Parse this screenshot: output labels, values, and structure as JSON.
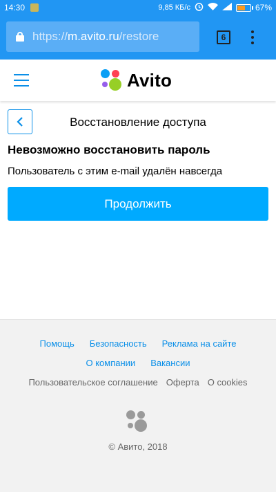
{
  "status_bar": {
    "time": "14:30",
    "speed": "9,85 КБ/с",
    "battery": "67%",
    "battery_level": 0.67
  },
  "browser": {
    "url_scheme": "https://",
    "url_host": "m.avito.ru",
    "url_path": "/restore",
    "tab_count": "6"
  },
  "header": {
    "logo_text": "Avito"
  },
  "main": {
    "page_title": "Восстановление доступа",
    "heading": "Невозможно восстановить пароль",
    "message": "Пользователь с этим e-mail удалён навсегда",
    "continue_label": "Продолжить"
  },
  "footer": {
    "row1": [
      "Помощь",
      "Безопасность",
      "Реклама на сайте"
    ],
    "row2": [
      "О компании",
      "Вакансии"
    ],
    "row3": [
      "Пользовательское соглашение",
      "Оферта",
      "О cookies"
    ],
    "copyright": "© Авито, 2018"
  },
  "colors": {
    "accent": "#2196f3",
    "link": "#0a8fe8",
    "button": "#00aaff",
    "logo_blue": "#0a9ff5",
    "logo_red": "#ff4053",
    "logo_purple": "#965eeb",
    "logo_green": "#97cf26"
  }
}
